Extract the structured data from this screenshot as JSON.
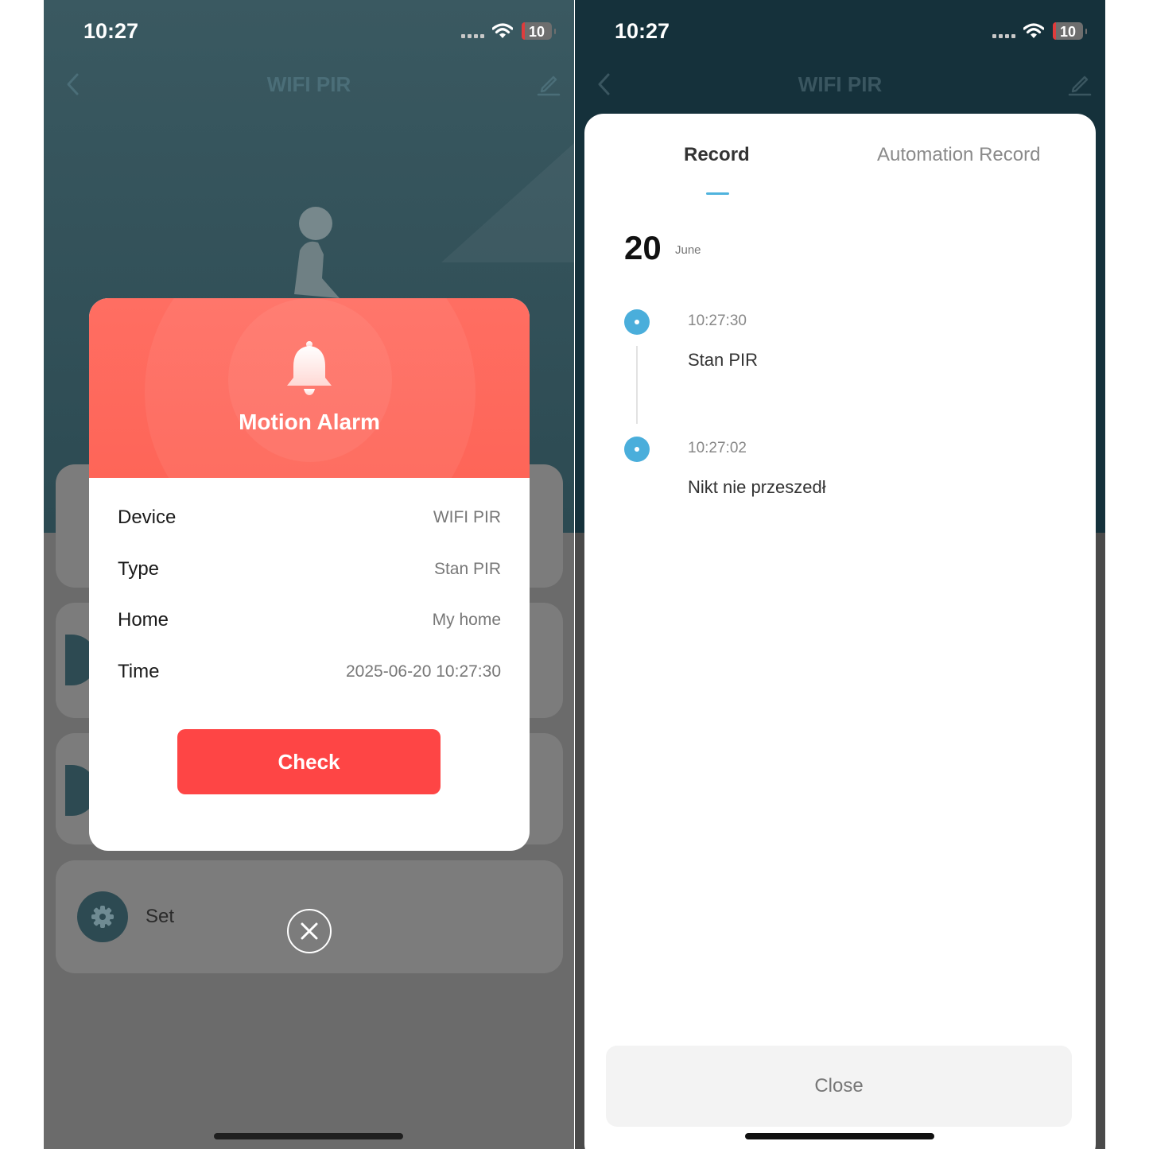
{
  "left_screen": {
    "status": {
      "time": "10:27",
      "battery": "10"
    },
    "nav": {
      "title": "WIFI PIR"
    },
    "set_card": {
      "label": "Set"
    },
    "alarm": {
      "title": "Motion Alarm",
      "rows": [
        {
          "key": "Device",
          "value": "WIFI PIR"
        },
        {
          "key": "Type",
          "value": "Stan PIR"
        },
        {
          "key": "Home",
          "value": "My home"
        },
        {
          "key": "Time",
          "value": "2025-06-20 10:27:30"
        }
      ],
      "check_label": "Check"
    }
  },
  "right_screen": {
    "status": {
      "time": "10:27",
      "battery": "10"
    },
    "nav": {
      "title": "WIFI PIR"
    },
    "tabs": [
      {
        "label": "Record",
        "active": true
      },
      {
        "label": "Automation Record",
        "active": false
      }
    ],
    "date": {
      "day": "20",
      "month": "June"
    },
    "records": [
      {
        "time": "10:27:30",
        "text": "Stan PIR"
      },
      {
        "time": "10:27:02",
        "text": "Nikt nie przeszedł"
      }
    ],
    "close_label": "Close"
  },
  "colors": {
    "alarm_header": "#ff6a5e",
    "check_button": "#fe4545",
    "accent": "#4aaedb",
    "hero_dark": "#15313b"
  },
  "icons": [
    "back-arrow-icon",
    "edit-pencil-icon",
    "bell-icon",
    "gear-icon",
    "close-icon",
    "wifi-icon",
    "signal-icon",
    "battery-icon"
  ]
}
